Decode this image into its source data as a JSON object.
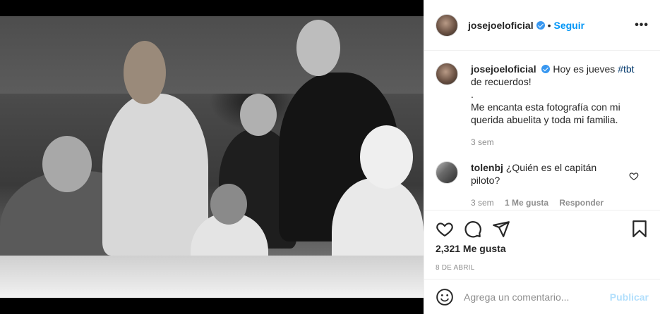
{
  "header": {
    "username": "josejoeloficial",
    "separator": "•",
    "follow_label": "Seguir",
    "more_label": "•••"
  },
  "caption": {
    "username": "josejoeloficial",
    "text_before_tag": "Hoy es jueves",
    "hashtag": "#tbt",
    "text_after_tag": "de recuerdos!",
    "line2": ".",
    "line3": "Me encanta esta fotografía con mi querida abuelita y toda mi familia.",
    "age": "3 sem"
  },
  "comment": {
    "username": "tolenbj",
    "text": "¿Quién es el capitán piloto?",
    "age": "3 sem",
    "likes": "1 Me gusta",
    "reply_label": "Responder"
  },
  "actions": {
    "like_icon": "heart-icon",
    "comment_icon": "comment-icon",
    "share_icon": "paper-plane-icon",
    "save_icon": "bookmark-icon",
    "likes_text": "2,321 Me gusta",
    "date": "8 DE ABRIL"
  },
  "add_comment": {
    "placeholder": "Agrega un comentario...",
    "publish_label": "Publicar"
  },
  "colors": {
    "accent": "#0095f6",
    "verified": "#3897f0",
    "hashtag": "#00376b",
    "publish_disabled": "#b2dffc",
    "muted": "#8e8e8e"
  }
}
